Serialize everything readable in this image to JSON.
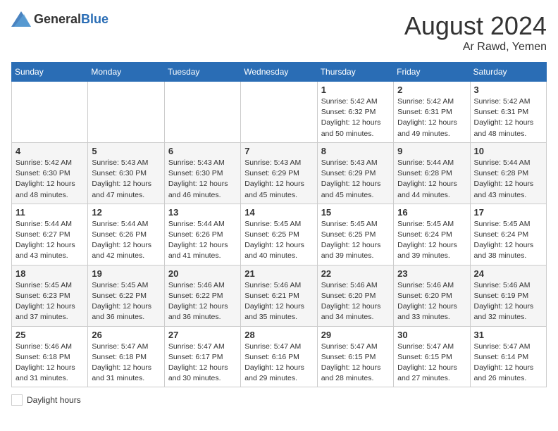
{
  "header": {
    "logo_general": "General",
    "logo_blue": "Blue",
    "month": "August 2024",
    "location": "Ar Rawd, Yemen"
  },
  "weekdays": [
    "Sunday",
    "Monday",
    "Tuesday",
    "Wednesday",
    "Thursday",
    "Friday",
    "Saturday"
  ],
  "weeks": [
    [
      {
        "day": "",
        "sunrise": "",
        "sunset": "",
        "daylight": ""
      },
      {
        "day": "",
        "sunrise": "",
        "sunset": "",
        "daylight": ""
      },
      {
        "day": "",
        "sunrise": "",
        "sunset": "",
        "daylight": ""
      },
      {
        "day": "",
        "sunrise": "",
        "sunset": "",
        "daylight": ""
      },
      {
        "day": "1",
        "sunrise": "Sunrise: 5:42 AM",
        "sunset": "Sunset: 6:32 PM",
        "daylight": "Daylight: 12 hours and 50 minutes."
      },
      {
        "day": "2",
        "sunrise": "Sunrise: 5:42 AM",
        "sunset": "Sunset: 6:31 PM",
        "daylight": "Daylight: 12 hours and 49 minutes."
      },
      {
        "day": "3",
        "sunrise": "Sunrise: 5:42 AM",
        "sunset": "Sunset: 6:31 PM",
        "daylight": "Daylight: 12 hours and 48 minutes."
      }
    ],
    [
      {
        "day": "4",
        "sunrise": "Sunrise: 5:42 AM",
        "sunset": "Sunset: 6:30 PM",
        "daylight": "Daylight: 12 hours and 48 minutes."
      },
      {
        "day": "5",
        "sunrise": "Sunrise: 5:43 AM",
        "sunset": "Sunset: 6:30 PM",
        "daylight": "Daylight: 12 hours and 47 minutes."
      },
      {
        "day": "6",
        "sunrise": "Sunrise: 5:43 AM",
        "sunset": "Sunset: 6:30 PM",
        "daylight": "Daylight: 12 hours and 46 minutes."
      },
      {
        "day": "7",
        "sunrise": "Sunrise: 5:43 AM",
        "sunset": "Sunset: 6:29 PM",
        "daylight": "Daylight: 12 hours and 45 minutes."
      },
      {
        "day": "8",
        "sunrise": "Sunrise: 5:43 AM",
        "sunset": "Sunset: 6:29 PM",
        "daylight": "Daylight: 12 hours and 45 minutes."
      },
      {
        "day": "9",
        "sunrise": "Sunrise: 5:44 AM",
        "sunset": "Sunset: 6:28 PM",
        "daylight": "Daylight: 12 hours and 44 minutes."
      },
      {
        "day": "10",
        "sunrise": "Sunrise: 5:44 AM",
        "sunset": "Sunset: 6:28 PM",
        "daylight": "Daylight: 12 hours and 43 minutes."
      }
    ],
    [
      {
        "day": "11",
        "sunrise": "Sunrise: 5:44 AM",
        "sunset": "Sunset: 6:27 PM",
        "daylight": "Daylight: 12 hours and 43 minutes."
      },
      {
        "day": "12",
        "sunrise": "Sunrise: 5:44 AM",
        "sunset": "Sunset: 6:26 PM",
        "daylight": "Daylight: 12 hours and 42 minutes."
      },
      {
        "day": "13",
        "sunrise": "Sunrise: 5:44 AM",
        "sunset": "Sunset: 6:26 PM",
        "daylight": "Daylight: 12 hours and 41 minutes."
      },
      {
        "day": "14",
        "sunrise": "Sunrise: 5:45 AM",
        "sunset": "Sunset: 6:25 PM",
        "daylight": "Daylight: 12 hours and 40 minutes."
      },
      {
        "day": "15",
        "sunrise": "Sunrise: 5:45 AM",
        "sunset": "Sunset: 6:25 PM",
        "daylight": "Daylight: 12 hours and 39 minutes."
      },
      {
        "day": "16",
        "sunrise": "Sunrise: 5:45 AM",
        "sunset": "Sunset: 6:24 PM",
        "daylight": "Daylight: 12 hours and 39 minutes."
      },
      {
        "day": "17",
        "sunrise": "Sunrise: 5:45 AM",
        "sunset": "Sunset: 6:24 PM",
        "daylight": "Daylight: 12 hours and 38 minutes."
      }
    ],
    [
      {
        "day": "18",
        "sunrise": "Sunrise: 5:45 AM",
        "sunset": "Sunset: 6:23 PM",
        "daylight": "Daylight: 12 hours and 37 minutes."
      },
      {
        "day": "19",
        "sunrise": "Sunrise: 5:45 AM",
        "sunset": "Sunset: 6:22 PM",
        "daylight": "Daylight: 12 hours and 36 minutes."
      },
      {
        "day": "20",
        "sunrise": "Sunrise: 5:46 AM",
        "sunset": "Sunset: 6:22 PM",
        "daylight": "Daylight: 12 hours and 36 minutes."
      },
      {
        "day": "21",
        "sunrise": "Sunrise: 5:46 AM",
        "sunset": "Sunset: 6:21 PM",
        "daylight": "Daylight: 12 hours and 35 minutes."
      },
      {
        "day": "22",
        "sunrise": "Sunrise: 5:46 AM",
        "sunset": "Sunset: 6:20 PM",
        "daylight": "Daylight: 12 hours and 34 minutes."
      },
      {
        "day": "23",
        "sunrise": "Sunrise: 5:46 AM",
        "sunset": "Sunset: 6:20 PM",
        "daylight": "Daylight: 12 hours and 33 minutes."
      },
      {
        "day": "24",
        "sunrise": "Sunrise: 5:46 AM",
        "sunset": "Sunset: 6:19 PM",
        "daylight": "Daylight: 12 hours and 32 minutes."
      }
    ],
    [
      {
        "day": "25",
        "sunrise": "Sunrise: 5:46 AM",
        "sunset": "Sunset: 6:18 PM",
        "daylight": "Daylight: 12 hours and 31 minutes."
      },
      {
        "day": "26",
        "sunrise": "Sunrise: 5:47 AM",
        "sunset": "Sunset: 6:18 PM",
        "daylight": "Daylight: 12 hours and 31 minutes."
      },
      {
        "day": "27",
        "sunrise": "Sunrise: 5:47 AM",
        "sunset": "Sunset: 6:17 PM",
        "daylight": "Daylight: 12 hours and 30 minutes."
      },
      {
        "day": "28",
        "sunrise": "Sunrise: 5:47 AM",
        "sunset": "Sunset: 6:16 PM",
        "daylight": "Daylight: 12 hours and 29 minutes."
      },
      {
        "day": "29",
        "sunrise": "Sunrise: 5:47 AM",
        "sunset": "Sunset: 6:15 PM",
        "daylight": "Daylight: 12 hours and 28 minutes."
      },
      {
        "day": "30",
        "sunrise": "Sunrise: 5:47 AM",
        "sunset": "Sunset: 6:15 PM",
        "daylight": "Daylight: 12 hours and 27 minutes."
      },
      {
        "day": "31",
        "sunrise": "Sunrise: 5:47 AM",
        "sunset": "Sunset: 6:14 PM",
        "daylight": "Daylight: 12 hours and 26 minutes."
      }
    ]
  ],
  "legend": {
    "daylight_label": "Daylight hours"
  }
}
